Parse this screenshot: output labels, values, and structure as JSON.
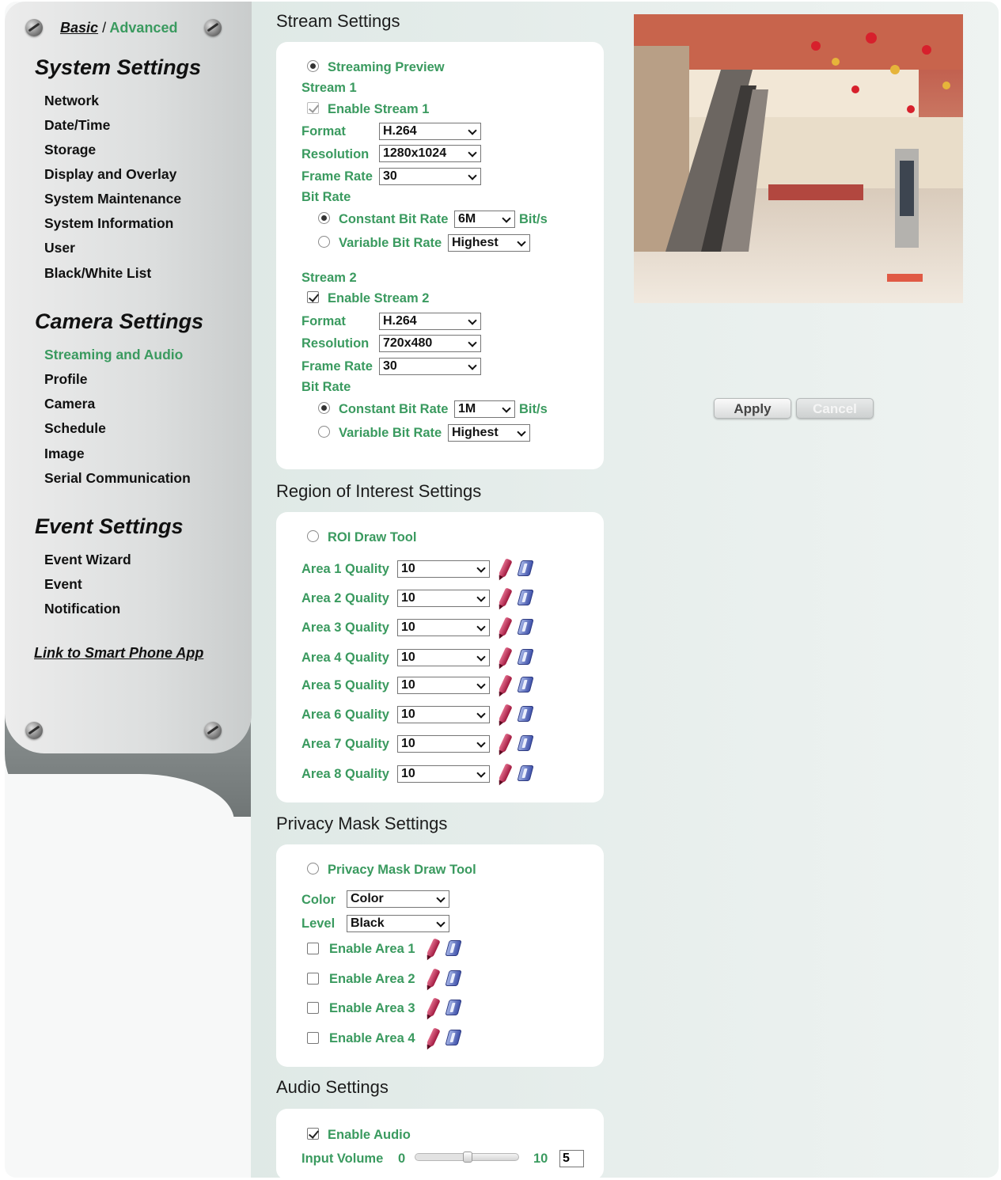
{
  "mode": {
    "basic": "Basic",
    "separator": "/",
    "advanced": "Advanced"
  },
  "sidebar": {
    "system_heading": "System Settings",
    "system_items": [
      "Network",
      "Date/Time",
      "Storage",
      "Display and Overlay",
      "System Maintenance",
      "System Information",
      "User",
      "Black/White List"
    ],
    "camera_heading": "Camera Settings",
    "camera_items": [
      "Streaming and Audio",
      "Profile",
      "Camera",
      "Schedule",
      "Image",
      "Serial Communication"
    ],
    "event_heading": "Event Settings",
    "event_items": [
      "Event Wizard",
      "Event",
      "Notification"
    ],
    "link": "Link to Smart Phone App"
  },
  "stream": {
    "title": "Stream Settings",
    "preview_label": "Streaming Preview",
    "labels": {
      "format": "Format",
      "resolution": "Resolution",
      "frame_rate": "Frame Rate",
      "bit_rate": "Bit Rate",
      "cbr": "Constant Bit Rate",
      "vbr": "Variable Bit Rate",
      "unit": "Bit/s"
    },
    "stream1": {
      "title": "Stream 1",
      "enable": "Enable Stream 1",
      "format": "H.264",
      "resolution": "1280x1024",
      "frame_rate": "30",
      "cbr_value": "6M",
      "vbr_value": "Highest"
    },
    "stream2": {
      "title": "Stream 2",
      "enable": "Enable Stream 2",
      "format": "H.264",
      "resolution": "720x480",
      "frame_rate": "30",
      "cbr_value": "1M",
      "vbr_value": "Highest"
    }
  },
  "actions": {
    "apply": "Apply",
    "cancel": "Cancel"
  },
  "roi": {
    "title": "Region of Interest Settings",
    "tool": "ROI Draw Tool",
    "areas": [
      {
        "label": "Area 1 Quality",
        "value": "10"
      },
      {
        "label": "Area 2 Quality",
        "value": "10"
      },
      {
        "label": "Area 3 Quality",
        "value": "10"
      },
      {
        "label": "Area 4 Quality",
        "value": "10"
      },
      {
        "label": "Area 5 Quality",
        "value": "10"
      },
      {
        "label": "Area 6 Quality",
        "value": "10"
      },
      {
        "label": "Area 7 Quality",
        "value": "10"
      },
      {
        "label": "Area 8 Quality",
        "value": "10"
      }
    ]
  },
  "privacy": {
    "title": "Privacy Mask Settings",
    "tool": "Privacy Mask Draw Tool",
    "color_label": "Color",
    "color_value": "Color",
    "level_label": "Level",
    "level_value": "Black",
    "areas": [
      "Enable Area 1",
      "Enable Area 2",
      "Enable Area 3",
      "Enable Area 4"
    ]
  },
  "audio": {
    "title": "Audio Settings",
    "enable": "Enable Audio",
    "input_volume_label": "Input Volume",
    "min": "0",
    "max": "10",
    "value": "5",
    "level": 0.5
  },
  "colors": {
    "accent": "#3a9a5f",
    "panel": "#ffffff",
    "main_bg": "#e3ece9"
  }
}
